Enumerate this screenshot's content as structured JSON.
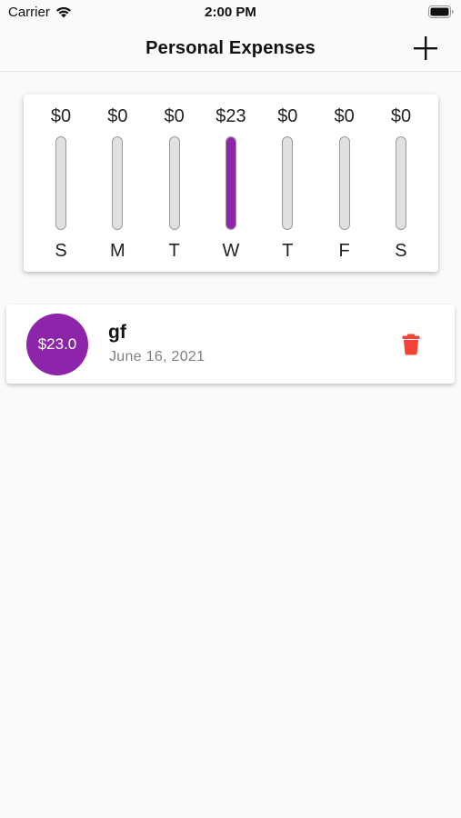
{
  "status_bar": {
    "carrier": "Carrier",
    "time": "2:00 PM"
  },
  "app_bar": {
    "title": "Personal Expenses",
    "add_icon": "plus-icon"
  },
  "chart_data": {
    "type": "bar",
    "categories": [
      "S",
      "M",
      "T",
      "W",
      "T",
      "F",
      "S"
    ],
    "values": [
      0,
      0,
      0,
      23,
      0,
      0,
      0
    ],
    "amount_labels": [
      "$0",
      "$0",
      "$0",
      "$23",
      "$0",
      "$0",
      "$0"
    ],
    "accent_color": "#8e24aa",
    "track_color": "#e0e0e0"
  },
  "transactions": [
    {
      "amount": "$23.0",
      "title": "gf",
      "date": "June 16, 2021",
      "delete_icon": "trash-icon",
      "delete_color": "#f44336"
    }
  ]
}
